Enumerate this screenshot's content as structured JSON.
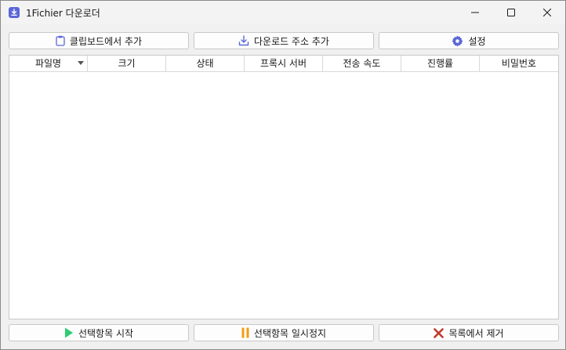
{
  "window": {
    "title": "1Fichier 다운로더"
  },
  "toolbar": {
    "clipboard_add": "클립보드에서 추가",
    "url_add": "다운로드 주소 추가",
    "settings": "설정"
  },
  "table": {
    "columns": [
      "파일명",
      "크기",
      "상태",
      "프록시 서버",
      "전송 속도",
      "진행률",
      "비밀번호"
    ],
    "rows": []
  },
  "actions": {
    "start_selected": "선택항목 시작",
    "pause_selected": "선택항목 일시정지",
    "remove_from_list": "목록에서 제거"
  },
  "colors": {
    "accent": "#5b67d8",
    "start_icon": "#2ecc71",
    "pause_icon": "#f39c12",
    "remove_icon": "#c0392b"
  },
  "icons": {
    "app": "download-app-icon",
    "clipboard": "clipboard-icon",
    "download": "download-icon",
    "settings": "gear-icon",
    "start": "play-icon",
    "pause": "pause-icon",
    "remove": "close-x-icon"
  }
}
